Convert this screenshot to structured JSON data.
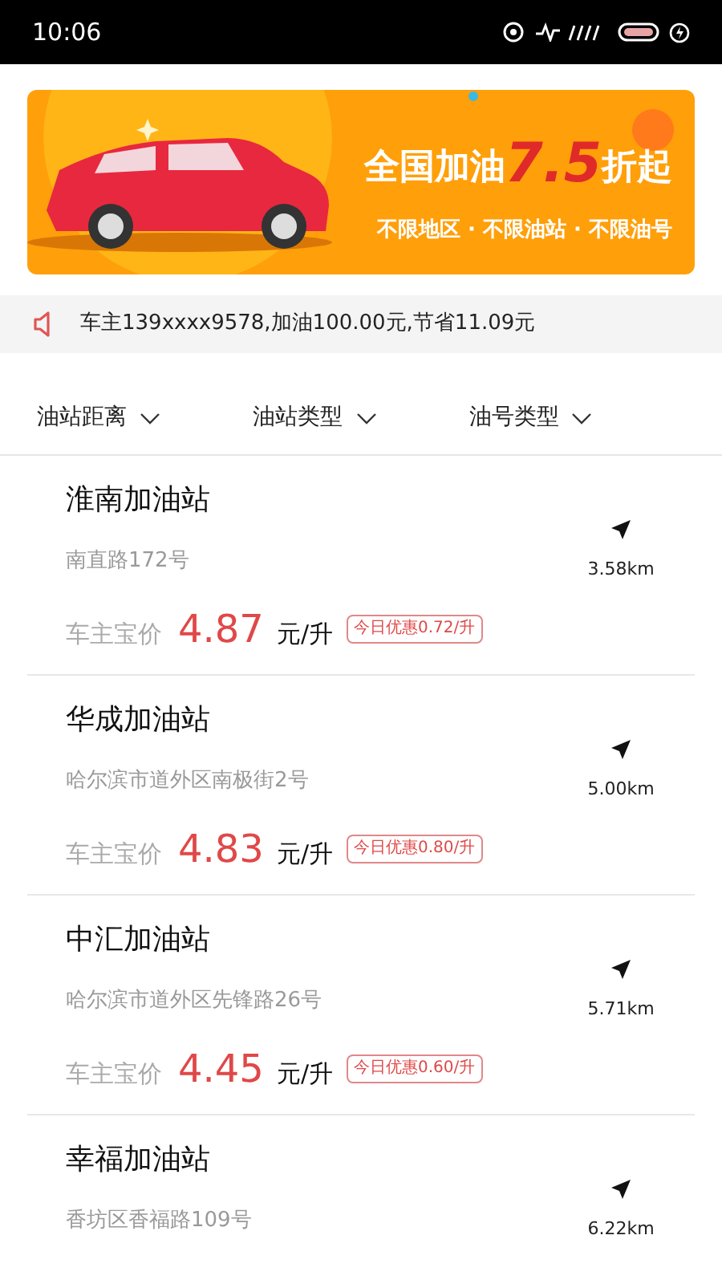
{
  "status_bar": {
    "time": "10:06"
  },
  "banner": {
    "kind": "picture",
    "headline": "全国加油",
    "highlight": "7.5",
    "headline_end": "折起",
    "subline": "不限地区 · 不限油站 · 不限油号"
  },
  "notice": {
    "text": "车主139xxxx9578,加油100.00元,节省11.09元"
  },
  "filters": [
    {
      "label": "油站距离"
    },
    {
      "label": "油站类型"
    },
    {
      "label": "油号类型"
    }
  ],
  "stations": [
    {
      "name": "淮南加油站",
      "address": "南直路172号",
      "distance": "3.58km",
      "price_label": "车主宝价",
      "price": "4.87",
      "unit": "元/升",
      "discount": "今日优惠0.72/升"
    },
    {
      "name": "华成加油站",
      "address": "哈尔滨市道外区南极街2号",
      "distance": "5.00km",
      "price_label": "车主宝价",
      "price": "4.83",
      "unit": "元/升",
      "discount": "今日优惠0.80/升"
    },
    {
      "name": "中汇加油站",
      "address": "哈尔滨市道外区先锋路26号",
      "distance": "5.71km",
      "price_label": "车主宝价",
      "price": "4.45",
      "unit": "元/升",
      "discount": "今日优惠0.60/升"
    },
    {
      "name": "幸福加油站",
      "address": "香坊区香福路109号",
      "distance": "6.22km"
    }
  ]
}
